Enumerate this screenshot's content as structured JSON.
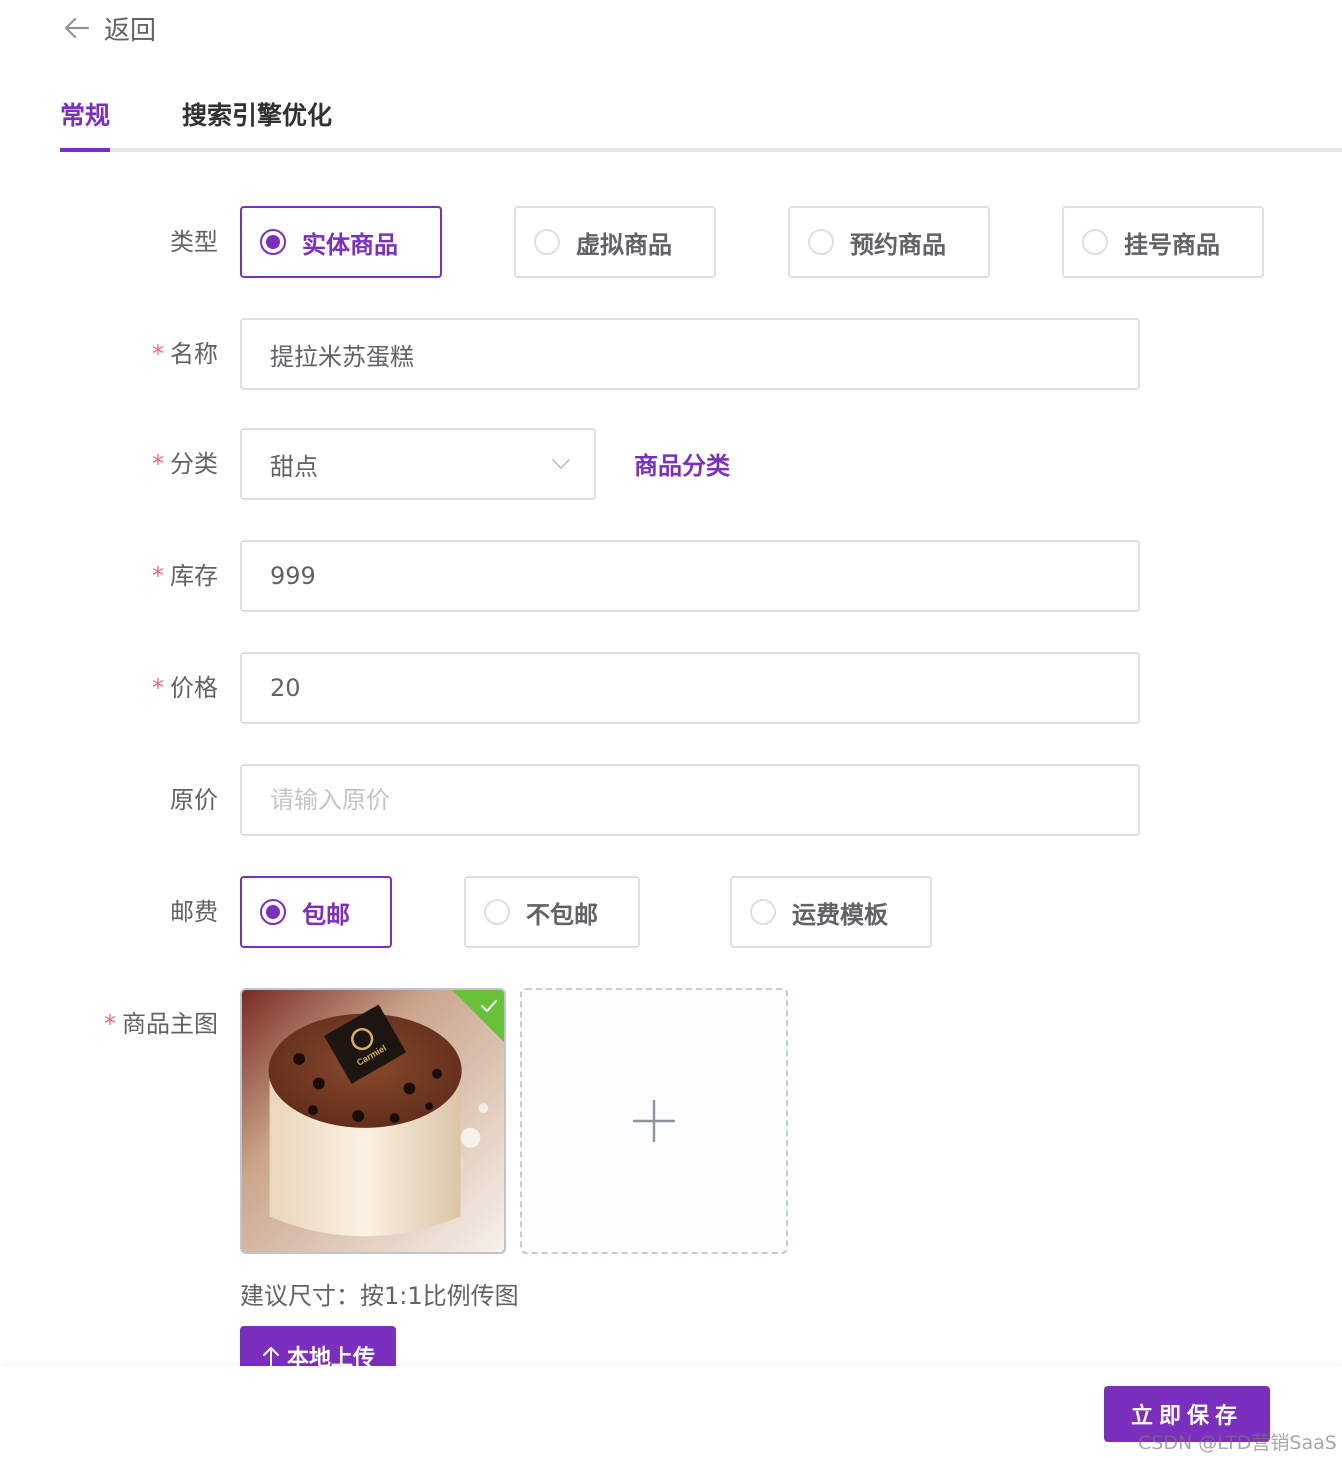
{
  "back": {
    "label": "返回",
    "icon": "arrow-left-icon"
  },
  "tabs": [
    {
      "label": "常规",
      "active": true
    },
    {
      "label": "搜索引擎优化",
      "active": false
    }
  ],
  "form": {
    "type": {
      "label": "类型",
      "options": [
        "实体商品",
        "虚拟商品",
        "预约商品",
        "挂号商品"
      ],
      "selected": "实体商品"
    },
    "name": {
      "label": "名称",
      "required": true,
      "value": "提拉米苏蛋糕"
    },
    "category": {
      "label": "分类",
      "required": true,
      "value": "甜点",
      "link": "商品分类"
    },
    "stock": {
      "label": "库存",
      "required": true,
      "value": "999"
    },
    "price": {
      "label": "价格",
      "required": true,
      "value": "20"
    },
    "original_price": {
      "label": "原价",
      "required": false,
      "value": "",
      "placeholder": "请输入原价"
    },
    "shipping": {
      "label": "邮费",
      "options": [
        "包邮",
        "不包邮",
        "运费模板"
      ],
      "selected": "包邮"
    },
    "main_image": {
      "label": "商品主图",
      "required": true,
      "image_text": "Carmiel",
      "hint": "建议尺寸：按1:1比例传图",
      "upload_button": "本地上传"
    }
  },
  "footer": {
    "save_button": "立即保存",
    "watermark": "CSDN @LTD营销SaaS"
  },
  "colors": {
    "accent": "#7b2fbe",
    "required": "#f56c6c",
    "success": "#67c23a",
    "border": "#dcdfe6"
  }
}
